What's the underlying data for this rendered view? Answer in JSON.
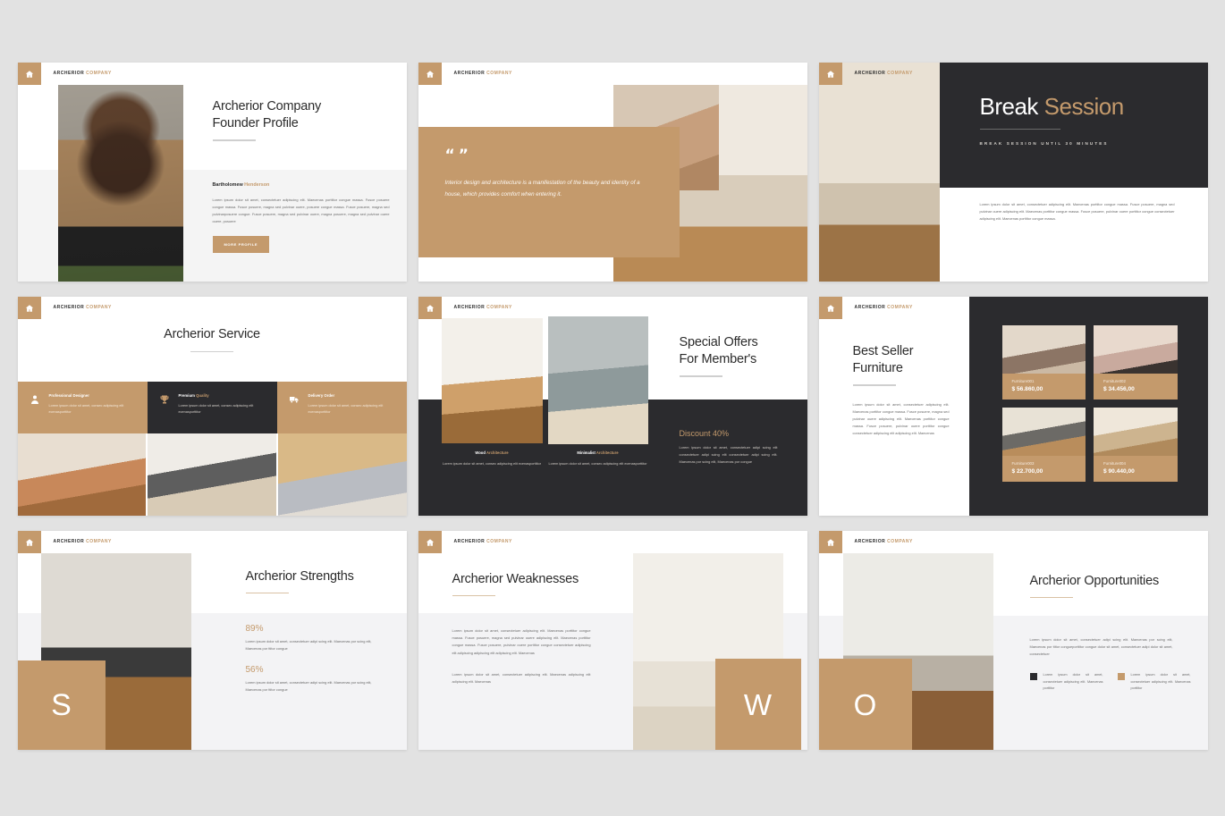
{
  "brand": {
    "part1": "ARCHERIOR",
    "part2": "COMPANY",
    "home_icon": "home-icon"
  },
  "colors": {
    "accent": "#c49a6c",
    "dark": "#2b2b2e",
    "page_bg": "#e2e2e2",
    "panel_light": "#f3f3f5"
  },
  "lorem": {
    "founder": "Lorem ipsum dolor sit amet, consectetuer adipiscing elit. Maecenas porttitor congue massa. Fusce posuere congue massa. Fusce posuere, magna sed pulvinar ouere, posuere congue massa. Fusce posuere, magna sed pulvinarposuere congue. Fusce posuere, magna sed pulvinar ouere, magna posuere, magna sed pulvinar ouere ouere, posuere",
    "break": "Lorem ipsum dolor sit amet, consectetuer adipiscing elit. Maecenas porttitor congue massa. Fusce posuere, magna sed pulvinar ouere adipiscing elit. Maecenas porttitor congue massa. Fusce posuere, pulvinar ouere porttitor congue consectetuer adipiscing elit. Maecenas porttitor congue massa.",
    "card": "Lorem ipsum dolor sit amet, consec adipiscing elit ecenasporttitor",
    "offer_caption": "Lorem ipsum dolor sit amet, consec adipiscing elit ecenasporttitor",
    "discount": "Lorem ipsum dolor sit amet, consectetuer adipi scing elit consectetuer adipi scing elit consectetuer adipi scing elit. Maecenas por scing elit, Maecenas por congue",
    "bestseller": "Lorem ipsum dolor sit amet, consectetuer adipiscing elit. Maecenas porttitor congue massa. Fusce posuere, magna sed pulvinar ouere adipiscing elit. Maecenas porttitor congue massa. Fusce posuere, pulvinar ouere porttitor congue consectetuer adipiscing elit adipiscing elit. Maecenas",
    "strength_item": "Lorem ipsum dolor sit amet, consectetuer adipi scing elit. Maecenas por scing elit, Maecenas por ttitor congue",
    "weakness_1": "Lorem ipsum dolor sit amet, consectetuer adipiscing elit. Maecenas porttitor congue massa. Fusce posuere, magna sed pulvinar ouere adipiscing elit. Maecenas porttitor congue massa. Fusce posuere, pulvinar ouere porttitor congue consectetuer adipiscing elit adipiscing adipiscing elit adipiscing elit. Maecenas",
    "weakness_2": "Lorem ipsum dolor sit amet, consectetuer adipiscing elit. Maecenas adipiscing elit adipiscing elit. Maecenas",
    "opportunity_main": "Lorem ipsum dolor sit amet, consectetuer adipi scing elit. Maecenas por scing elit, Maecenas por ttitor congueporttitor congue dolor sit amet, consectetuer adipi dolor sit amet, consectetuer",
    "opportunity_bullet": "Lorem ipsum dolor sit amet, consectetuer adipiscing elit. Maecenas porttitor"
  },
  "slides": [
    {
      "id": "founder-profile",
      "title": "Archerior Company\nFounder Profile",
      "title_line1": "Archerior Company",
      "title_line2": "Founder Profile",
      "name_first": "Bartholomew ",
      "name_last": "Henderson",
      "button": "MORE PROFILE"
    },
    {
      "id": "quote",
      "quote_open": "“",
      "quote_close": "”",
      "quote": "Interior design and architecture is a manifestation of the beauty and identity of a house, which provides comfort when entering it."
    },
    {
      "id": "break-session",
      "title_1": "Break ",
      "title_2": "Session",
      "subtitle": "BREAK SESSION UNTIL 30 MINUTES"
    },
    {
      "id": "archerior-service",
      "title": "Archerior Service",
      "cards": [
        {
          "icon": "user-icon",
          "label_1": "Professional Designer",
          "label_2": "",
          "theme": "tan"
        },
        {
          "icon": "trophy-icon",
          "label_1": "Premium ",
          "label_2": "Quality",
          "theme": "dark"
        },
        {
          "icon": "delivery-truck-icon",
          "label_1": "Delivery Order",
          "label_2": "",
          "theme": "tan"
        }
      ]
    },
    {
      "id": "special-offers",
      "title_line1": "Special Offers",
      "title_line2": "For Member's",
      "caption_1a": "Wood ",
      "caption_1b": "Architecture",
      "caption_2a": "Minimalist ",
      "caption_2b": "Architecture",
      "discount_heading": "Discount 40%"
    },
    {
      "id": "best-seller-furniture",
      "title_line1": "Best Seller",
      "title_line2": "Furniture",
      "items": [
        {
          "name": "Furniture001",
          "price": "$ 56.860,00"
        },
        {
          "name": "Furniture002",
          "price": "$ 34.456,00"
        },
        {
          "name": "Furniture003",
          "price": "$ 22.700,00"
        },
        {
          "name": "Furniture004",
          "price": "$ 90.440,00"
        }
      ]
    },
    {
      "id": "archerior-strengths",
      "title": "Archerior Strengths",
      "letter": "S",
      "stats": [
        {
          "value": "89%"
        },
        {
          "value": "56%"
        }
      ]
    },
    {
      "id": "archerior-weaknesses",
      "title": "Archerior Weaknesses",
      "letter": "W"
    },
    {
      "id": "archerior-opportunities",
      "title": "Archerior Opportunities",
      "letter": "O"
    }
  ]
}
